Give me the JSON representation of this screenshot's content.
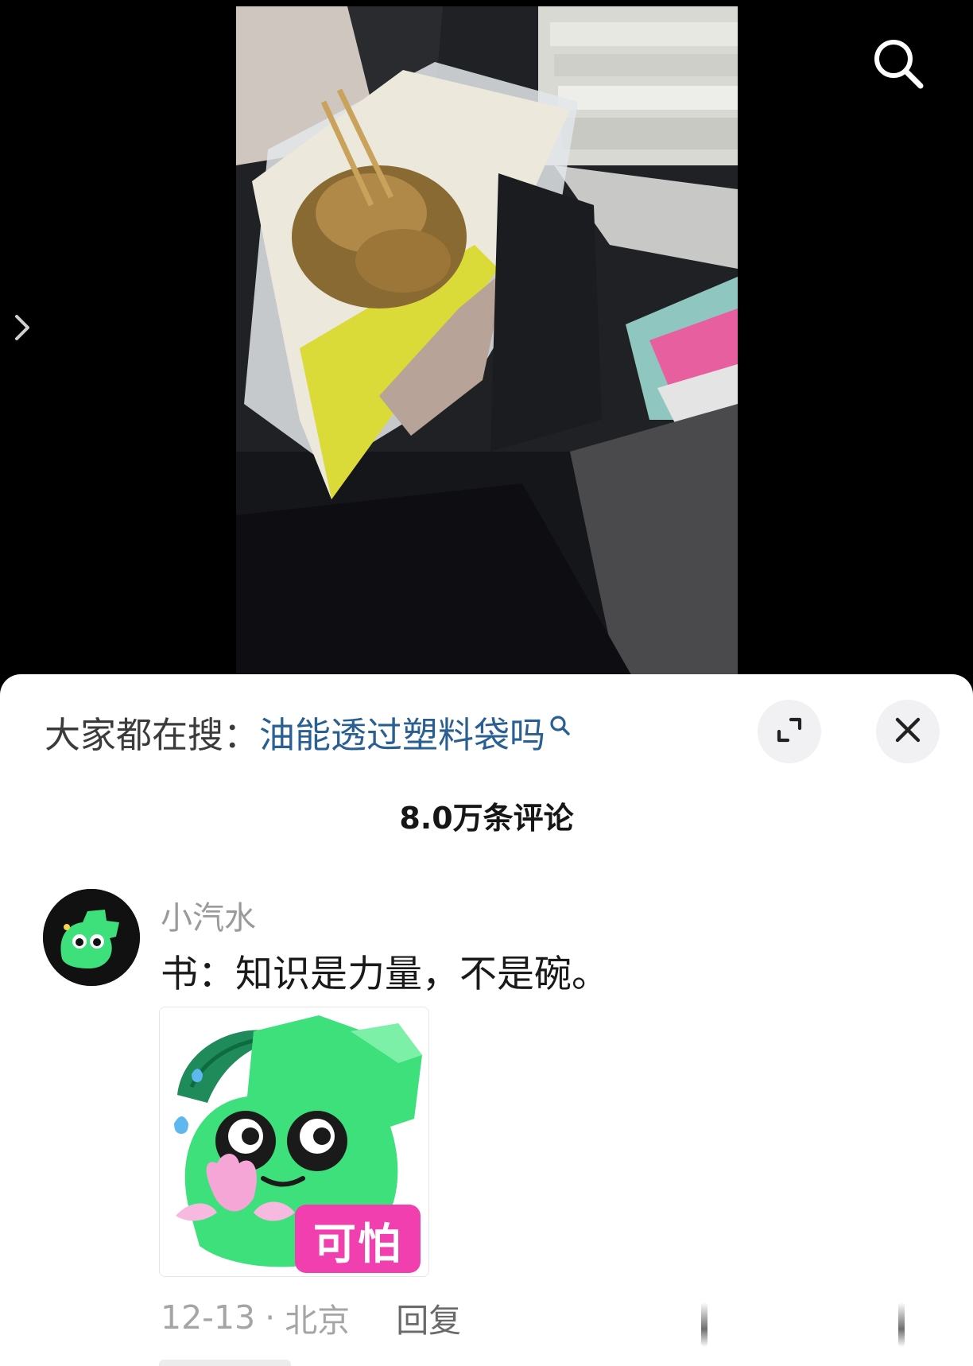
{
  "video": {
    "search_icon": "search-icon",
    "side_arrow_icon": "chevron-right-icon"
  },
  "sheet": {
    "trend_prefix": "大家都在搜：",
    "trend_query": "油能透过塑料袋吗",
    "trend_icon": "search-icon",
    "expand_icon": "expand-icon",
    "close_icon": "close-icon",
    "comment_count": "8.0万条评论"
  },
  "comment": {
    "username": "小汽水",
    "text": "书：知识是力量，不是碗。",
    "sticker_label": "可怕",
    "date": "12-13",
    "separator": "·",
    "location": "北京",
    "reply_label": "回复"
  },
  "colors": {
    "link": "#2a5f93",
    "sticker_green": "#3de07a",
    "sticker_pink": "#f23fb0"
  }
}
